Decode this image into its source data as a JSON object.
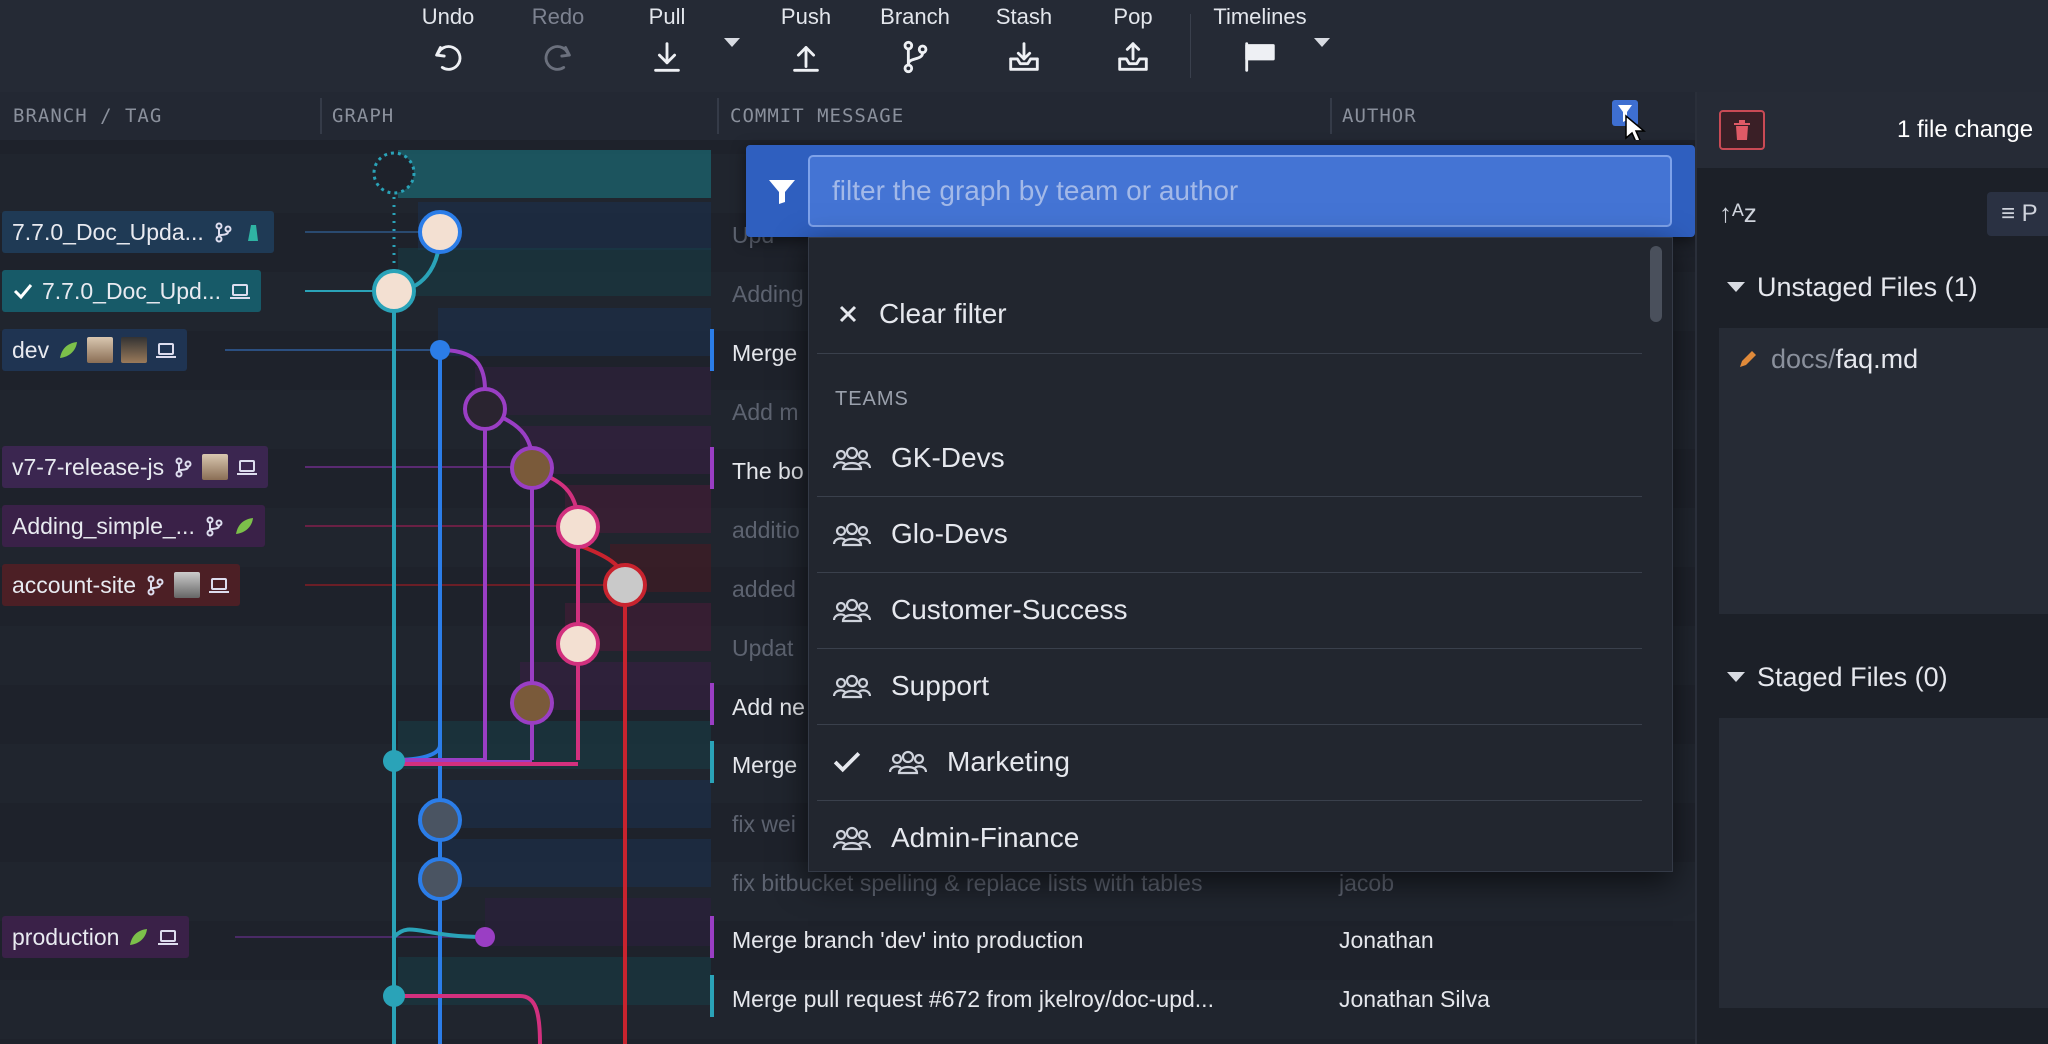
{
  "toolbar": {
    "undo": "Undo",
    "redo": "Redo",
    "pull": "Pull",
    "push": "Push",
    "branch": "Branch",
    "stash": "Stash",
    "pop": "Pop",
    "timelines": "Timelines"
  },
  "columns": {
    "branch_tag": "BRANCH / TAG",
    "graph": "GRAPH",
    "commit_message": "COMMIT MESSAGE",
    "author": "AUTHOR"
  },
  "branches": [
    {
      "label": "7.7.0_Doc_Upda..."
    },
    {
      "label": "7.7.0_Doc_Upd..."
    },
    {
      "label": "dev"
    },
    {
      "label": "v7-7-release-js"
    },
    {
      "label": "Adding_simple_..."
    },
    {
      "label": "account-site"
    },
    {
      "label": "production"
    }
  ],
  "commits": [
    {
      "msg": "Upd",
      "author": ""
    },
    {
      "msg": "Adding",
      "author": ""
    },
    {
      "msg": "Merge",
      "author": ""
    },
    {
      "msg": "Add m",
      "author": ""
    },
    {
      "msg": "The bo",
      "author": ""
    },
    {
      "msg": "additio",
      "author": ""
    },
    {
      "msg": "added",
      "author": ""
    },
    {
      "msg": "Updat",
      "author": ""
    },
    {
      "msg": "Add ne",
      "author": ""
    },
    {
      "msg": "Merge",
      "author": ""
    },
    {
      "msg": "fix wei",
      "author": ""
    },
    {
      "msg": "fix bitbucket spelling & replace lists with tables",
      "author": "jacob"
    },
    {
      "msg": "Merge branch 'dev' into production",
      "author": "Jonathan"
    },
    {
      "msg": "Merge pull request #672 from jkelroy/doc-upd...",
      "author": "Jonathan Silva"
    }
  ],
  "filter": {
    "placeholder": "filter the graph by team or author",
    "clear": "Clear filter",
    "teams_header": "TEAMS",
    "teams": [
      {
        "name": "GK-Devs",
        "checked": false
      },
      {
        "name": "Glo-Devs",
        "checked": false
      },
      {
        "name": "Customer-Success",
        "checked": false
      },
      {
        "name": "Support",
        "checked": false
      },
      {
        "name": "Marketing",
        "checked": true
      },
      {
        "name": "Admin-Finance",
        "checked": false
      }
    ]
  },
  "right_panel": {
    "title": "1 file change",
    "path_button": "≡ P",
    "unstaged": "Unstaged Files (1)",
    "staged": "Staged Files (0)",
    "file_dir": "docs/",
    "file_name": "faq.md"
  },
  "icons": {
    "undo": "undo-icon",
    "redo": "redo-icon",
    "pull": "pull-icon",
    "push": "push-icon",
    "branch": "branch-icon",
    "stash": "stash-icon",
    "pop": "pop-icon",
    "timelines": "timelines-icon",
    "filter": "filter-icon",
    "trash": "trash-icon",
    "team": "team-icon",
    "sort": "sort-icon"
  },
  "colors": {
    "accent": "#2f5fbf",
    "teal": "#2aa3b8",
    "blue": "#2b7de8",
    "purple": "#9a3ec4",
    "magenta": "#d2307e",
    "red": "#c8232e"
  }
}
